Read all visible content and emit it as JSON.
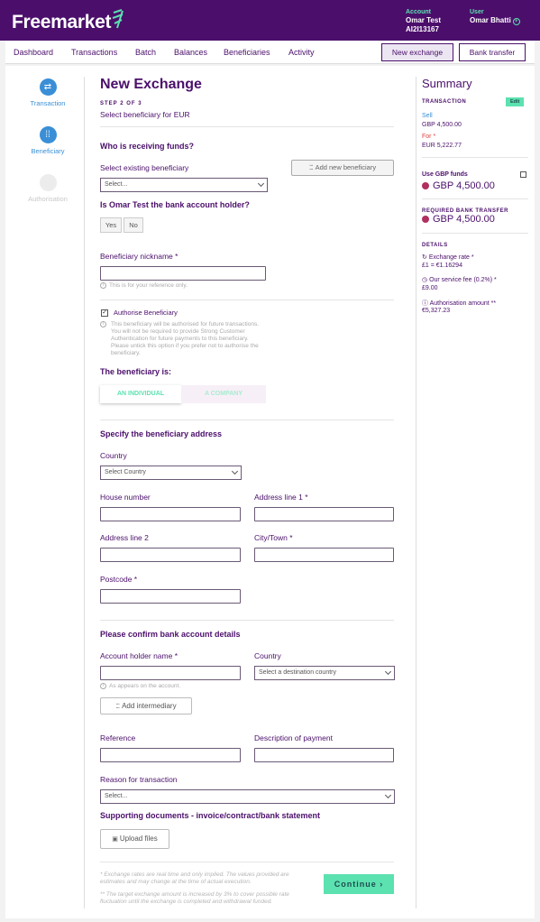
{
  "header": {
    "brand": "Freemarket",
    "account_label": "Account",
    "account_name": "Omar Test",
    "account_id": "AI2I13167",
    "user_label": "User",
    "user_name": "Omar Bhatti"
  },
  "nav": {
    "items": [
      "Dashboard",
      "Transactions",
      "Batch",
      "Balances",
      "Beneficiaries",
      "Activity"
    ],
    "new_exchange": "New exchange",
    "bank_transfer": "Bank transfer"
  },
  "steps": [
    {
      "label": "Transaction",
      "icon": "swap-icon"
    },
    {
      "label": "Beneficiary",
      "icon": "dots-icon"
    },
    {
      "label": "Authorisation",
      "icon": "circle-icon"
    }
  ],
  "form": {
    "title": "New Exchange",
    "step_indicator": "STEP 2 OF 3",
    "subtitle": "Select beneficiary for EUR",
    "receiving_heading": "Who is receiving funds?",
    "existing_label": "Select existing beneficiary",
    "add_new_button": "Add new beneficiary",
    "existing_select": "Select...",
    "holder_question": "Is Omar Test the bank account holder?",
    "yes": "Yes",
    "no": "No",
    "nickname_label": "Beneficiary nickname *",
    "nickname_hint": "This is for your reference only.",
    "authorise_label": "Authorise Beneficiary",
    "authorise_hint": "This beneficiary will be authorised for future transactions. You will not be required to provide Strong Customer Authentication for future payments to this beneficiary. Please untick this option if you prefer not to authorise the beneficiary.",
    "beneficiary_is": "The beneficiary is:",
    "individual": "AN INDIVIDUAL",
    "company": "A COMPANY",
    "address_heading": "Specify the beneficiary address",
    "country_label": "Country",
    "country_select": "Select Country",
    "house_label": "House number",
    "addr1_label": "Address line 1 *",
    "addr2_label": "Address line 2",
    "city_label": "City/Town *",
    "postcode_label": "Postcode *",
    "bank_heading": "Please confirm bank account details",
    "holder_name_label": "Account holder name *",
    "bank_country_label": "Country",
    "bank_country_select": "Select a destination country",
    "holder_hint": "As appears on the account.",
    "intermediary_button": "Add intermediary",
    "reference_label": "Reference",
    "description_label": "Description of payment",
    "reason_label": "Reason for transaction",
    "reason_select": "Select...",
    "docs_heading": "Supporting documents - invoice/contract/bank statement",
    "upload_button": "Upload files",
    "footnote1": "* Exchange rates are real time and only implied. The values provided are estimates and may change at the time of actual execution.",
    "footnote2": "** The target exchange amount is increased by 3% to cover possible rate fluctuation until the exchange is completed and withdrawal funded.",
    "continue_button": "Continue"
  },
  "summary": {
    "title": "Summary",
    "transaction_cap": "TRANSACTION",
    "edit": "Edit",
    "sell_label": "Sell",
    "sell_value": "GBP 4,500.00",
    "for_label": "For *",
    "for_value": "EUR 5,222.77",
    "use_funds": "Use GBP funds",
    "funds_amount": "GBP  4,500.00",
    "required_cap": "REQUIRED BANK TRANSFER",
    "required_amount": "GBP  4,500.00",
    "details_cap": "DETAILS",
    "rate_label": "Exchange rate *",
    "rate_value": "£1 = €1.16294",
    "fee_label": "Our service fee (0.2%) *",
    "fee_value": "£9.00",
    "auth_label": "Authorisation amount **",
    "auth_value": "€5,327.23"
  },
  "colors": {
    "brand_purple": "#4b0f6b",
    "accent_green": "#5ce1b0",
    "step_blue": "#3a8fd6"
  }
}
